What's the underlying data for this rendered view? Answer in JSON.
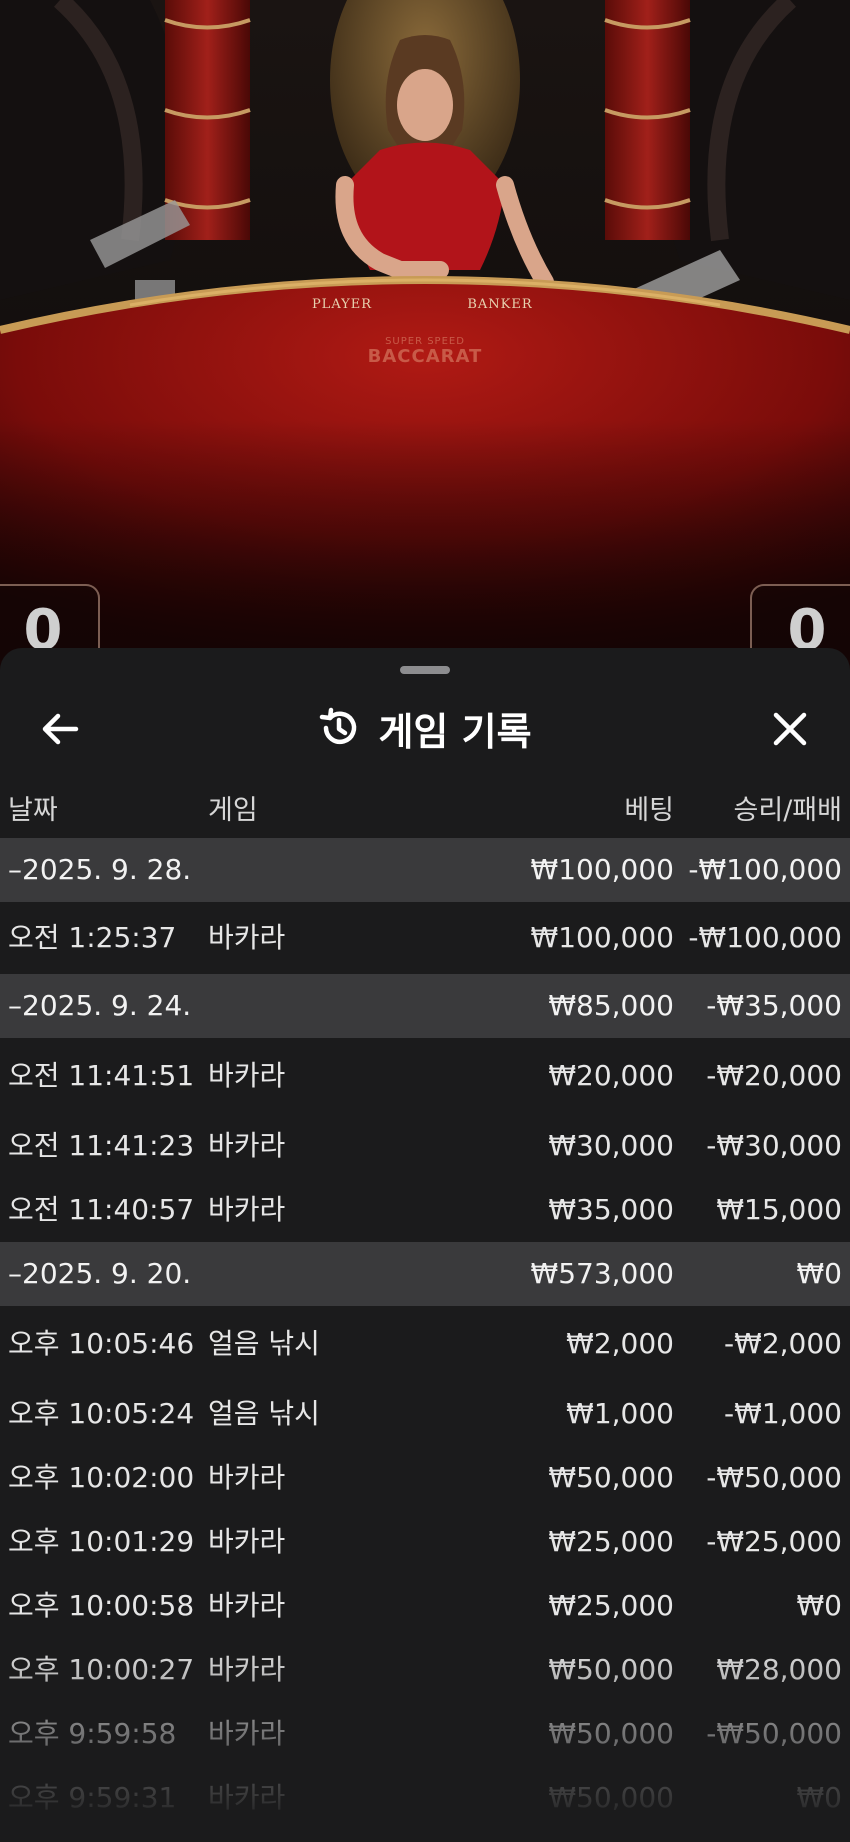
{
  "scene": {
    "table_labels": {
      "player": "PLAYER",
      "banker": "BANKER"
    },
    "table_logo": {
      "line1": "SUPER SPEED",
      "line2": "BACCARAT"
    },
    "score_left": "0",
    "score_right": "0"
  },
  "sheet": {
    "title": "게임 기록",
    "icons": {
      "back": "arrow-left-icon",
      "history": "history-icon",
      "close": "close-icon"
    },
    "columns": {
      "date": "날짜",
      "game": "게임",
      "bet": "베팅",
      "winloss": "승리/패배"
    },
    "groups": [
      {
        "date": "–2025. 9. 28.",
        "bet": "₩100,000",
        "winloss": "-₩100,000",
        "rows": [
          {
            "time": "오전 1:25:37",
            "game": "바카라",
            "bet": "₩100,000",
            "winloss": "-₩100,000"
          }
        ]
      },
      {
        "date": "–2025. 9. 24.",
        "bet": "₩85,000",
        "winloss": "-₩35,000",
        "rows": [
          {
            "time": "오전 11:41:51",
            "game": "바카라",
            "bet": "₩20,000",
            "winloss": "-₩20,000"
          },
          {
            "time": "오전 11:41:23",
            "game": "바카라",
            "bet": "₩30,000",
            "winloss": "-₩30,000"
          },
          {
            "time": "오전 11:40:57",
            "game": "바카라",
            "bet": "₩35,000",
            "winloss": "₩15,000"
          }
        ]
      },
      {
        "date": "–2025. 9. 20.",
        "bet": "₩573,000",
        "winloss": "₩0",
        "rows": [
          {
            "time": "오후 10:05:46",
            "game": "얼음 낚시",
            "bet": "₩2,000",
            "winloss": "-₩2,000"
          },
          {
            "time": "오후 10:05:24",
            "game": "얼음 낚시",
            "bet": "₩1,000",
            "winloss": "-₩1,000"
          },
          {
            "time": "오후 10:02:00",
            "game": "바카라",
            "bet": "₩50,000",
            "winloss": "-₩50,000"
          },
          {
            "time": "오후 10:01:29",
            "game": "바카라",
            "bet": "₩25,000",
            "winloss": "-₩25,000"
          },
          {
            "time": "오후 10:00:58",
            "game": "바카라",
            "bet": "₩25,000",
            "winloss": "₩0"
          },
          {
            "time": "오후 10:00:27",
            "game": "바카라",
            "bet": "₩50,000",
            "winloss": "₩28,000"
          },
          {
            "time": "오후 9:59:58",
            "game": "바카라",
            "bet": "₩50,000",
            "winloss": "-₩50,000"
          },
          {
            "time": "오후 9:59:31",
            "game": "바카라",
            "bet": "₩50,000",
            "winloss": "₩0"
          }
        ]
      }
    ]
  }
}
